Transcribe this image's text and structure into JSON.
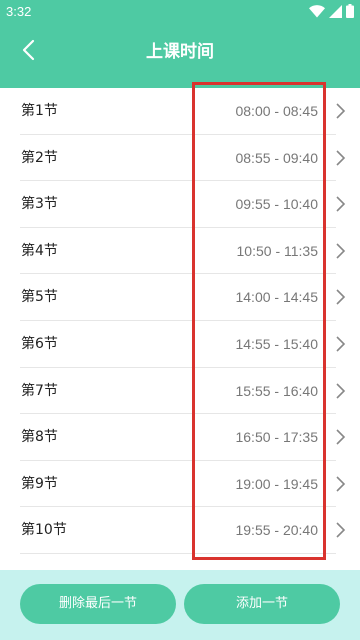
{
  "status_bar": {
    "time": "3:32",
    "icons": [
      "wifi-icon",
      "signal-icon",
      "battery-icon"
    ]
  },
  "header": {
    "title": "上课时间",
    "back_icon": "back-arrow-icon"
  },
  "periods": [
    {
      "label": "第1节",
      "time": "08:00 - 08:45"
    },
    {
      "label": "第2节",
      "time": "08:55 - 09:40"
    },
    {
      "label": "第3节",
      "time": "09:55 - 10:40"
    },
    {
      "label": "第4节",
      "time": "10:50 - 11:35"
    },
    {
      "label": "第5节",
      "time": "14:00 - 14:45"
    },
    {
      "label": "第6节",
      "time": "14:55 - 15:40"
    },
    {
      "label": "第7节",
      "time": "15:55 - 16:40"
    },
    {
      "label": "第8节",
      "time": "16:50 - 17:35"
    },
    {
      "label": "第9节",
      "time": "19:00 - 19:45"
    },
    {
      "label": "第10节",
      "time": "19:55 - 20:40"
    }
  ],
  "actions": {
    "delete_last": "删除最后一节",
    "add_one": "添加一节"
  },
  "colors": {
    "primary": "#4ecaa3",
    "bottom_bar": "#c6f2ee",
    "highlight": "#d9332e"
  }
}
